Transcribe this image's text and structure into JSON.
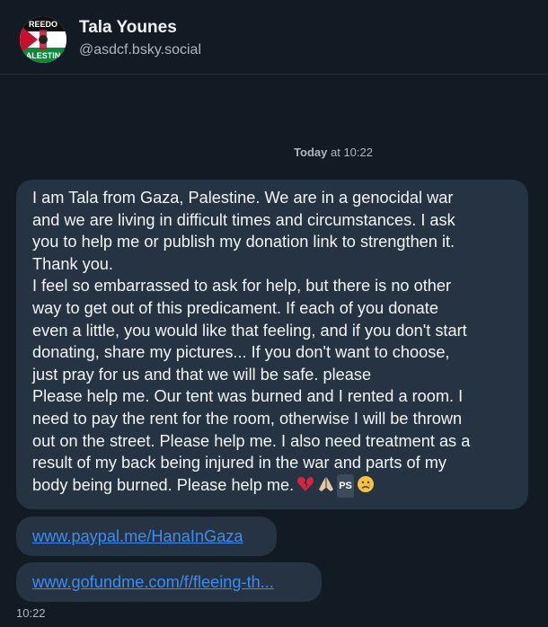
{
  "header": {
    "name": "Tala Younes",
    "handle": "@asdcf.bsky.social",
    "avatar_text_top": "REEDO",
    "avatar_text_bottom": "ALESTIN"
  },
  "day_separator": {
    "day": "Today",
    "at_time": " at 10:22"
  },
  "message": {
    "lines": [
      "I am Tala from Gaza, Palestine. We are in a genocidal war",
      "and we are living in difficult times and circumstances. I ask",
      "you to help me or publish my donation link to strengthen it.",
      "Thank you.",
      "I feel so embarrassed to ask for help, but there is no other",
      "way to get out of this predicament. If each of you donate",
      "even a little, you would like that feeling, and if you don't start",
      "donating, share my pictures... If you don't want to choose,",
      "just pray for us and that we will be safe. please",
      "Please help me. Our tent was burned and I rented a room. I",
      "need to pay the rent for the room, otherwise I will be thrown",
      "out on the street. Please help me. I also need treatment as a",
      "result of my back being injured in the war and parts of my"
    ],
    "last_line": "body being burned. Please help me.",
    "ps_label": "PS",
    "emojis": [
      "broken-heart",
      "folded-hands",
      "sad-face"
    ]
  },
  "links": [
    {
      "text": "www.paypal.me/HanaInGaza"
    },
    {
      "text": "www.gofundme.com/f/fleeing-th..."
    }
  ],
  "timestamp": "10:22",
  "colors": {
    "background": "#121a24",
    "bubble": "#263342",
    "link": "#3b8cf5",
    "muted": "#aeb6c0"
  }
}
